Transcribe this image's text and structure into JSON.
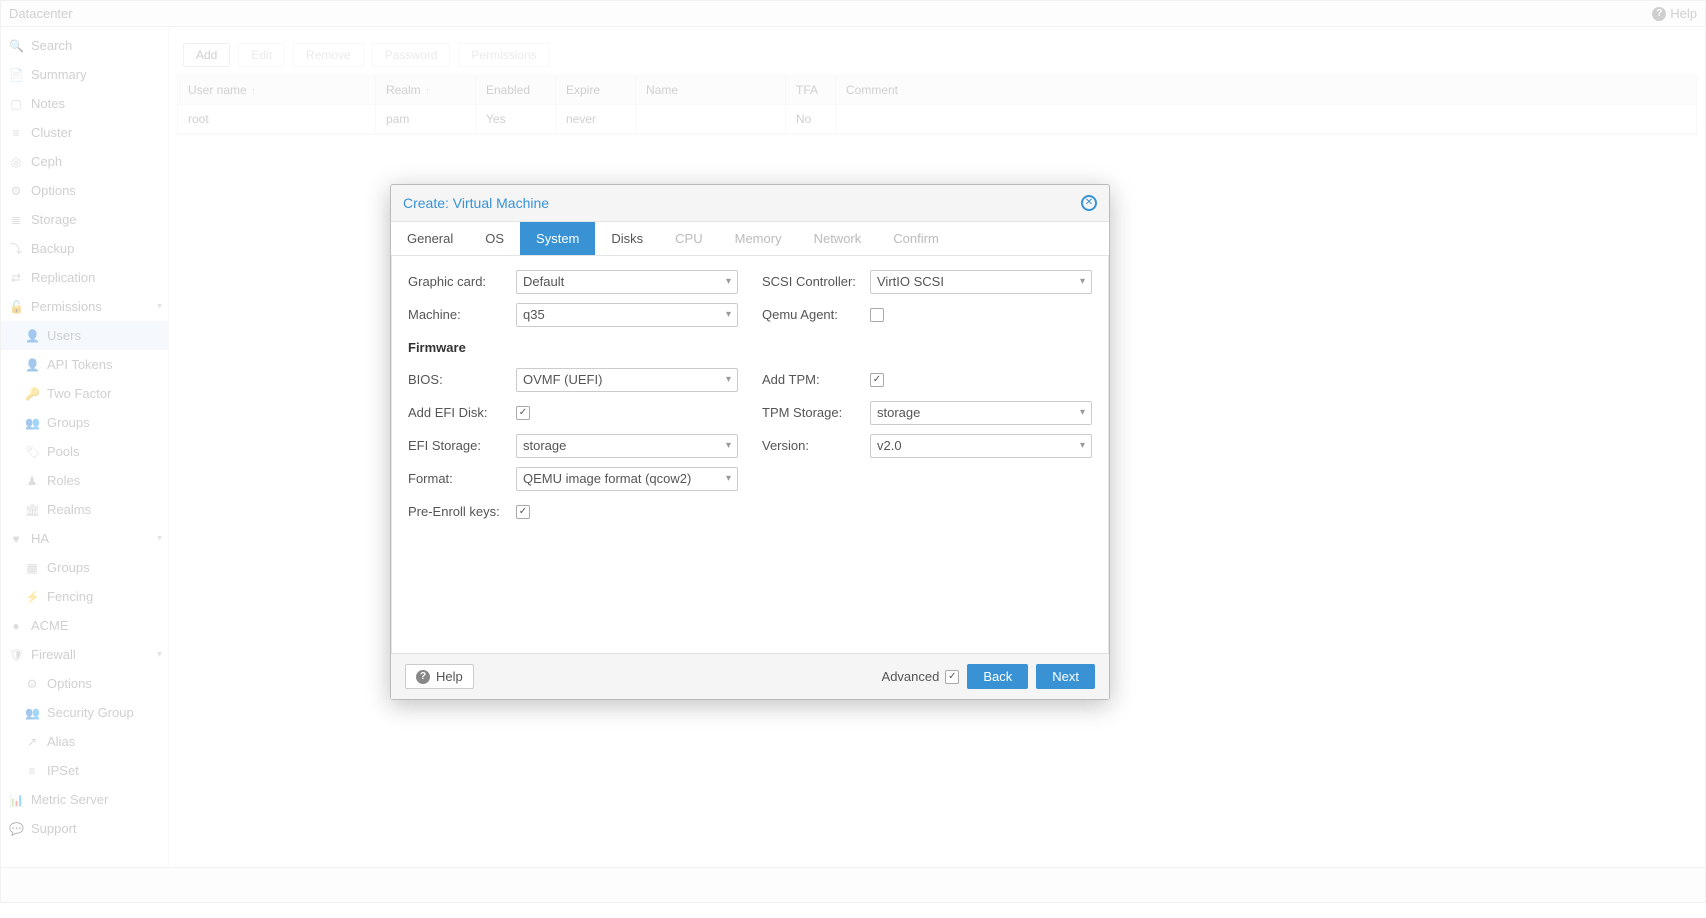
{
  "header": {
    "title": "Datacenter",
    "help": "Help"
  },
  "sidebar": {
    "items": [
      {
        "icon": "🔍",
        "label": "Search",
        "name": "search"
      },
      {
        "icon": "📄",
        "label": "Summary",
        "name": "summary"
      },
      {
        "icon": "▢",
        "label": "Notes",
        "name": "notes"
      },
      {
        "icon": "≡",
        "label": "Cluster",
        "name": "cluster"
      },
      {
        "icon": "◎",
        "label": "Ceph",
        "name": "ceph"
      },
      {
        "icon": "⚙",
        "label": "Options",
        "name": "options"
      },
      {
        "icon": "≣",
        "label": "Storage",
        "name": "storage"
      },
      {
        "icon": "⤵",
        "label": "Backup",
        "name": "backup"
      },
      {
        "icon": "⇄",
        "label": "Replication",
        "name": "replication"
      },
      {
        "icon": "🔓",
        "label": "Permissions",
        "name": "permissions",
        "expandable": true
      },
      {
        "icon": "👤",
        "label": "Users",
        "name": "users",
        "sub": true,
        "active": true
      },
      {
        "icon": "👤",
        "label": "API Tokens",
        "name": "api-tokens",
        "sub": true
      },
      {
        "icon": "🔑",
        "label": "Two Factor",
        "name": "two-factor",
        "sub": true
      },
      {
        "icon": "👥",
        "label": "Groups",
        "name": "groups",
        "sub": true
      },
      {
        "icon": "🏷",
        "label": "Pools",
        "name": "pools",
        "sub": true
      },
      {
        "icon": "♟",
        "label": "Roles",
        "name": "roles",
        "sub": true
      },
      {
        "icon": "🏛",
        "label": "Realms",
        "name": "realms",
        "sub": true
      },
      {
        "icon": "♥",
        "label": "HA",
        "name": "ha",
        "expandable": true
      },
      {
        "icon": "▦",
        "label": "Groups",
        "name": "ha-groups",
        "sub": true
      },
      {
        "icon": "⚡",
        "label": "Fencing",
        "name": "fencing",
        "sub": true
      },
      {
        "icon": "●",
        "label": "ACME",
        "name": "acme"
      },
      {
        "icon": "🛡",
        "label": "Firewall",
        "name": "firewall",
        "expandable": true
      },
      {
        "icon": "⚙",
        "label": "Options",
        "name": "fw-options",
        "sub": true
      },
      {
        "icon": "👥",
        "label": "Security Group",
        "name": "security-group",
        "sub": true
      },
      {
        "icon": "↗",
        "label": "Alias",
        "name": "alias",
        "sub": true
      },
      {
        "icon": "≡",
        "label": "IPSet",
        "name": "ipset",
        "sub": true
      },
      {
        "icon": "📊",
        "label": "Metric Server",
        "name": "metric-server"
      },
      {
        "icon": "💬",
        "label": "Support",
        "name": "support"
      }
    ]
  },
  "toolbar": {
    "add": "Add",
    "edit": "Edit",
    "remove": "Remove",
    "password": "Password",
    "permissions": "Permissions"
  },
  "grid": {
    "headers": {
      "user": "User name",
      "realm": "Realm",
      "enabled": "Enabled",
      "expire": "Expire",
      "name": "Name",
      "tfa": "TFA",
      "comment": "Comment"
    },
    "rows": [
      {
        "user": "root",
        "realm": "pam",
        "enabled": "Yes",
        "expire": "never",
        "name": "",
        "tfa": "No",
        "comment": ""
      }
    ]
  },
  "modal": {
    "title": "Create: Virtual Machine",
    "tabs": [
      "General",
      "OS",
      "System",
      "Disks",
      "CPU",
      "Memory",
      "Network",
      "Confirm"
    ],
    "activeTab": "System",
    "disabledTabs": [
      "CPU",
      "Memory",
      "Network",
      "Confirm"
    ],
    "left": {
      "graphicCard": {
        "label": "Graphic card:",
        "value": "Default"
      },
      "machine": {
        "label": "Machine:",
        "value": "q35"
      },
      "firmwareSection": "Firmware",
      "bios": {
        "label": "BIOS:",
        "value": "OVMF (UEFI)"
      },
      "addEfi": {
        "label": "Add EFI Disk:",
        "checked": true
      },
      "efiStorage": {
        "label": "EFI Storage:",
        "value": "storage"
      },
      "format": {
        "label": "Format:",
        "value": "QEMU image format (qcow2)"
      },
      "preEnroll": {
        "label": "Pre-Enroll keys:",
        "checked": true
      }
    },
    "right": {
      "scsi": {
        "label": "SCSI Controller:",
        "value": "VirtIO SCSI"
      },
      "qemuAgent": {
        "label": "Qemu Agent:",
        "checked": false
      },
      "addTpm": {
        "label": "Add TPM:",
        "checked": true
      },
      "tpmStorage": {
        "label": "TPM Storage:",
        "value": "storage"
      },
      "version": {
        "label": "Version:",
        "value": "v2.0"
      }
    },
    "footer": {
      "help": "Help",
      "advanced": "Advanced",
      "advancedChecked": true,
      "back": "Back",
      "next": "Next"
    }
  }
}
